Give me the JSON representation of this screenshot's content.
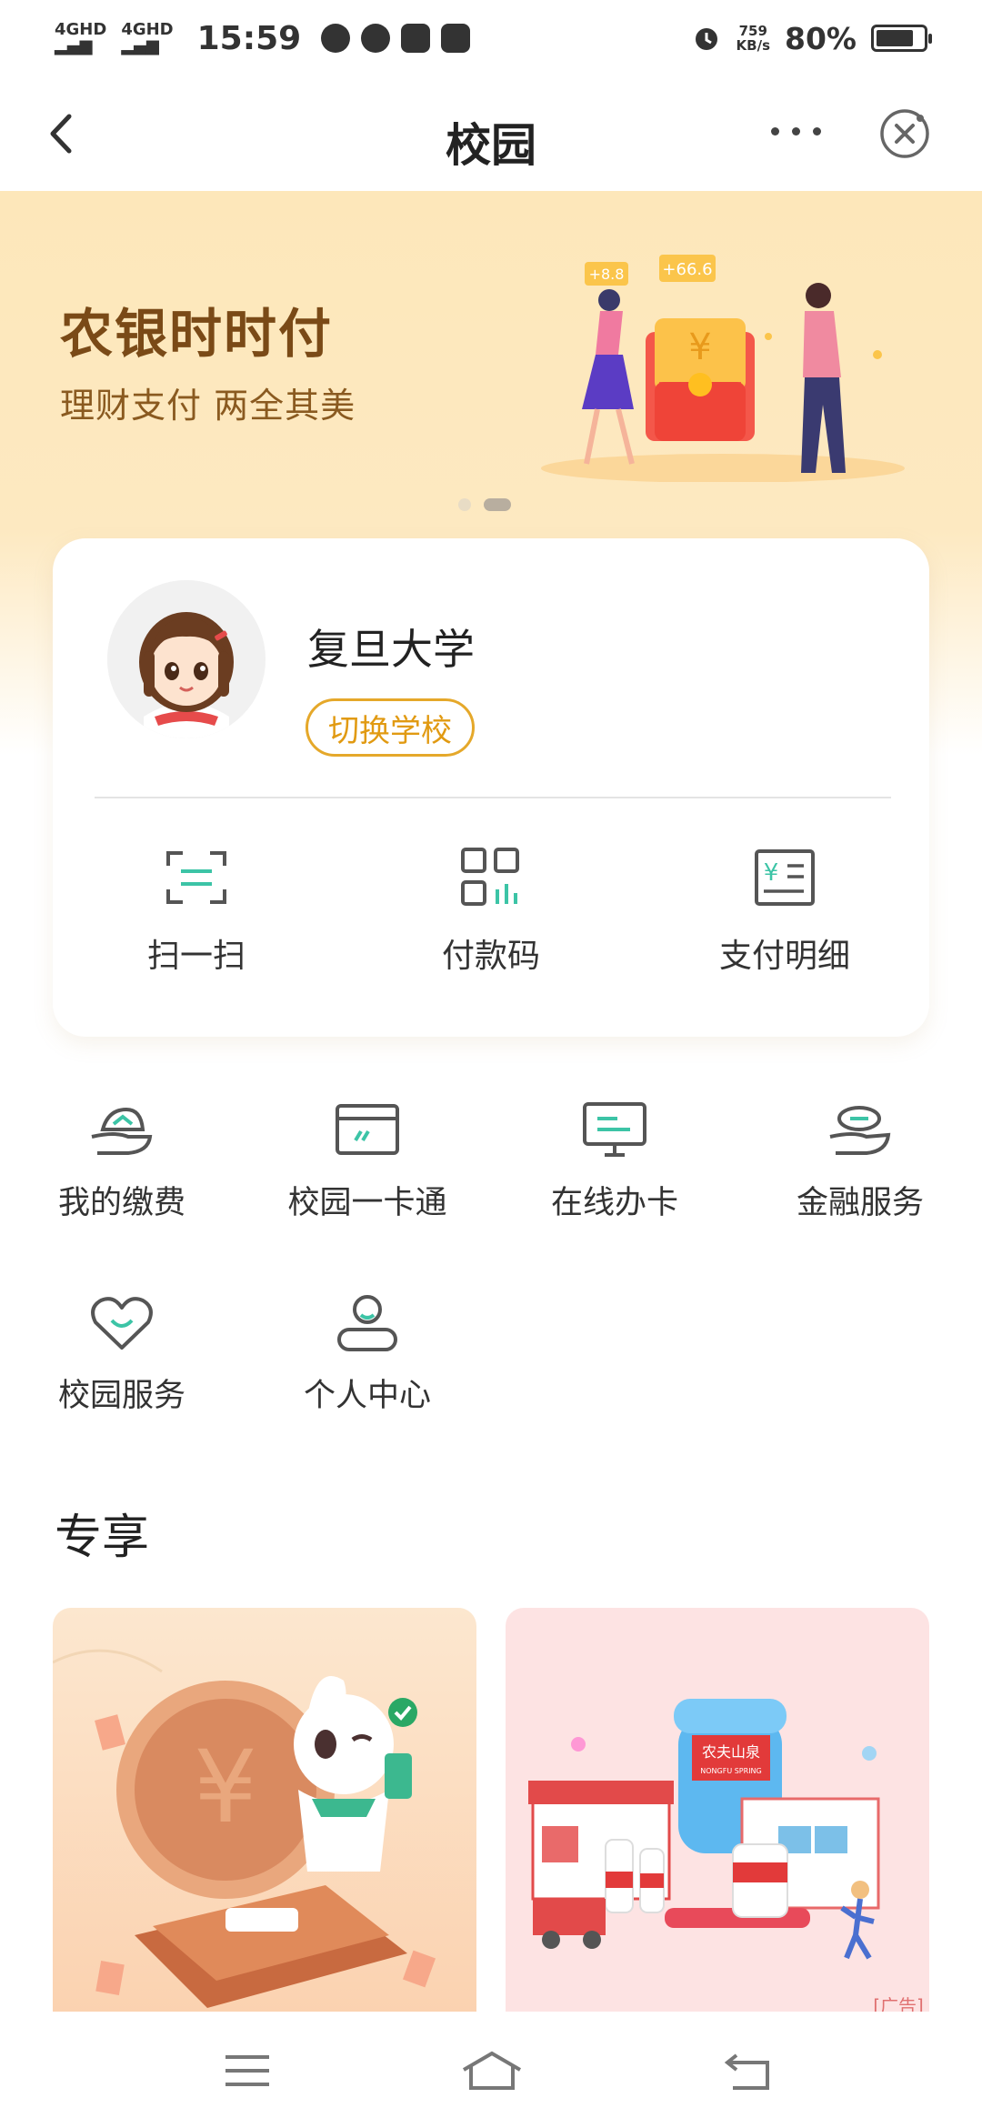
{
  "status_bar": {
    "network1": "4GHD",
    "network2": "4GHD",
    "time": "15:59",
    "speed_value": "759",
    "speed_unit": "KB/s",
    "battery": "80%",
    "battery_level": 0.8
  },
  "navbar": {
    "title": "校园"
  },
  "banner": {
    "title": "农银时时付",
    "subtitle": "理财支付 两全其美",
    "tag1": "+8.8",
    "tag2": "+66.6",
    "page_count": 2,
    "active_page": 2
  },
  "profile": {
    "school": "复旦大学",
    "switch_label": "切换学校"
  },
  "quick_actions": [
    {
      "label": "扫一扫",
      "icon": "scan-icon"
    },
    {
      "label": "付款码",
      "icon": "qr-code-icon"
    },
    {
      "label": "支付明细",
      "icon": "payment-detail-icon"
    }
  ],
  "services": [
    {
      "label": "我的缴费",
      "icon": "payment-hand-icon"
    },
    {
      "label": "校园一卡通",
      "icon": "campus-card-icon"
    },
    {
      "label": "在线办卡",
      "icon": "monitor-card-icon"
    },
    {
      "label": "金融服务",
      "icon": "finance-hand-icon"
    },
    {
      "label": "校园服务",
      "icon": "heart-icon"
    },
    {
      "label": "个人中心",
      "icon": "person-icon"
    }
  ],
  "exclusive": {
    "title": "专享",
    "ad_label": "[广告]",
    "brand1": "农夫山泉",
    "brand1_en": "NONGFU SPRING"
  },
  "colors": {
    "accent_green": "#3cc4a6",
    "switch_orange": "#e5a82a",
    "banner_bg": "#fde7ba",
    "title_brown": "#7a4a17"
  }
}
